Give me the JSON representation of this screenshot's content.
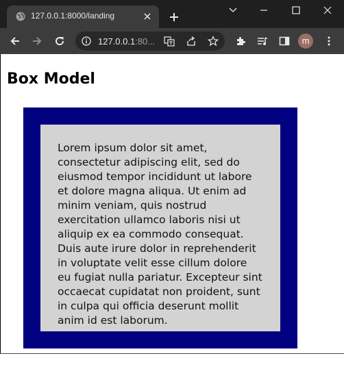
{
  "browser": {
    "tab_title": "127.0.0.1:8000/landing",
    "address_host": "127.0.0.1",
    "address_rest": ":80...",
    "profile_initial": "m",
    "colors": {
      "tabstrip": "#1f1f1f",
      "toolbar": "#3c3c3c",
      "omnibox": "#282828"
    }
  },
  "page": {
    "title": "Box Model",
    "paragraph": "Lorem ipsum dolor sit amet, consectetur adipiscing elit, sed do eiusmod tempor incididunt ut labore et dolore magna aliqua. Ut enim ad minim veniam, quis nostrud exercitation ullamco laboris nisi ut aliquip ex ea commodo consequat. Duis aute irure dolor in reprehenderit in voluptate velit esse cillum dolore eu fugiat nulla pariatur. Excepteur sint occaecat cupidatat non proident, sunt in culpa qui officia deserunt mollit anim id est laborum.",
    "colors": {
      "outer_box": "#000080",
      "inner_box": "#d3d3d3"
    }
  }
}
